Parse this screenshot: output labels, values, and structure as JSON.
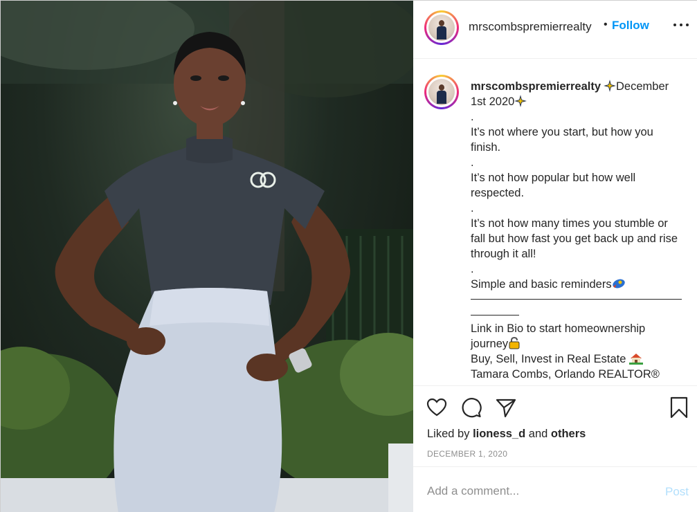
{
  "post": {
    "username": "mrscombspremierrealty",
    "follow_separator": "•",
    "follow_label": "Follow",
    "more_icon": "more-horizontal-icon"
  },
  "caption": {
    "username": "mrscombspremierrealty",
    "line1": "December 1st 2020",
    "dot1": ".",
    "p1": "It’s not where you start, but how you finish.",
    "dot2": ".",
    "p2": "It’s not how popular but how well respected.",
    "dot3": ".",
    "p3": "It’s not how many times you stumble or fall but how fast you get back up and rise through it all!",
    "dot4": ".",
    "p4": "Simple and basic reminders",
    "p5": "Link in Bio to start homeownership journey",
    "p6": "Buy, Sell, Invest in Real Estate",
    "p7": "Tamara Combs, Orlando REALTOR®"
  },
  "actions": {
    "icons": [
      "heart-icon",
      "comment-icon",
      "share-icon",
      "bookmark-icon"
    ],
    "liked_by_prefix": "Liked by",
    "liked_by_user": "lioness_d",
    "liked_by_and": "and",
    "liked_by_others": "others",
    "date": "DECEMBER 1, 2020"
  },
  "comment": {
    "placeholder": "Add a comment...",
    "post_label": "Post"
  },
  "colors": {
    "accent": "#0095f6",
    "post_disabled": "#b2dffc",
    "muted": "#8e8e8e",
    "text": "#262626"
  }
}
